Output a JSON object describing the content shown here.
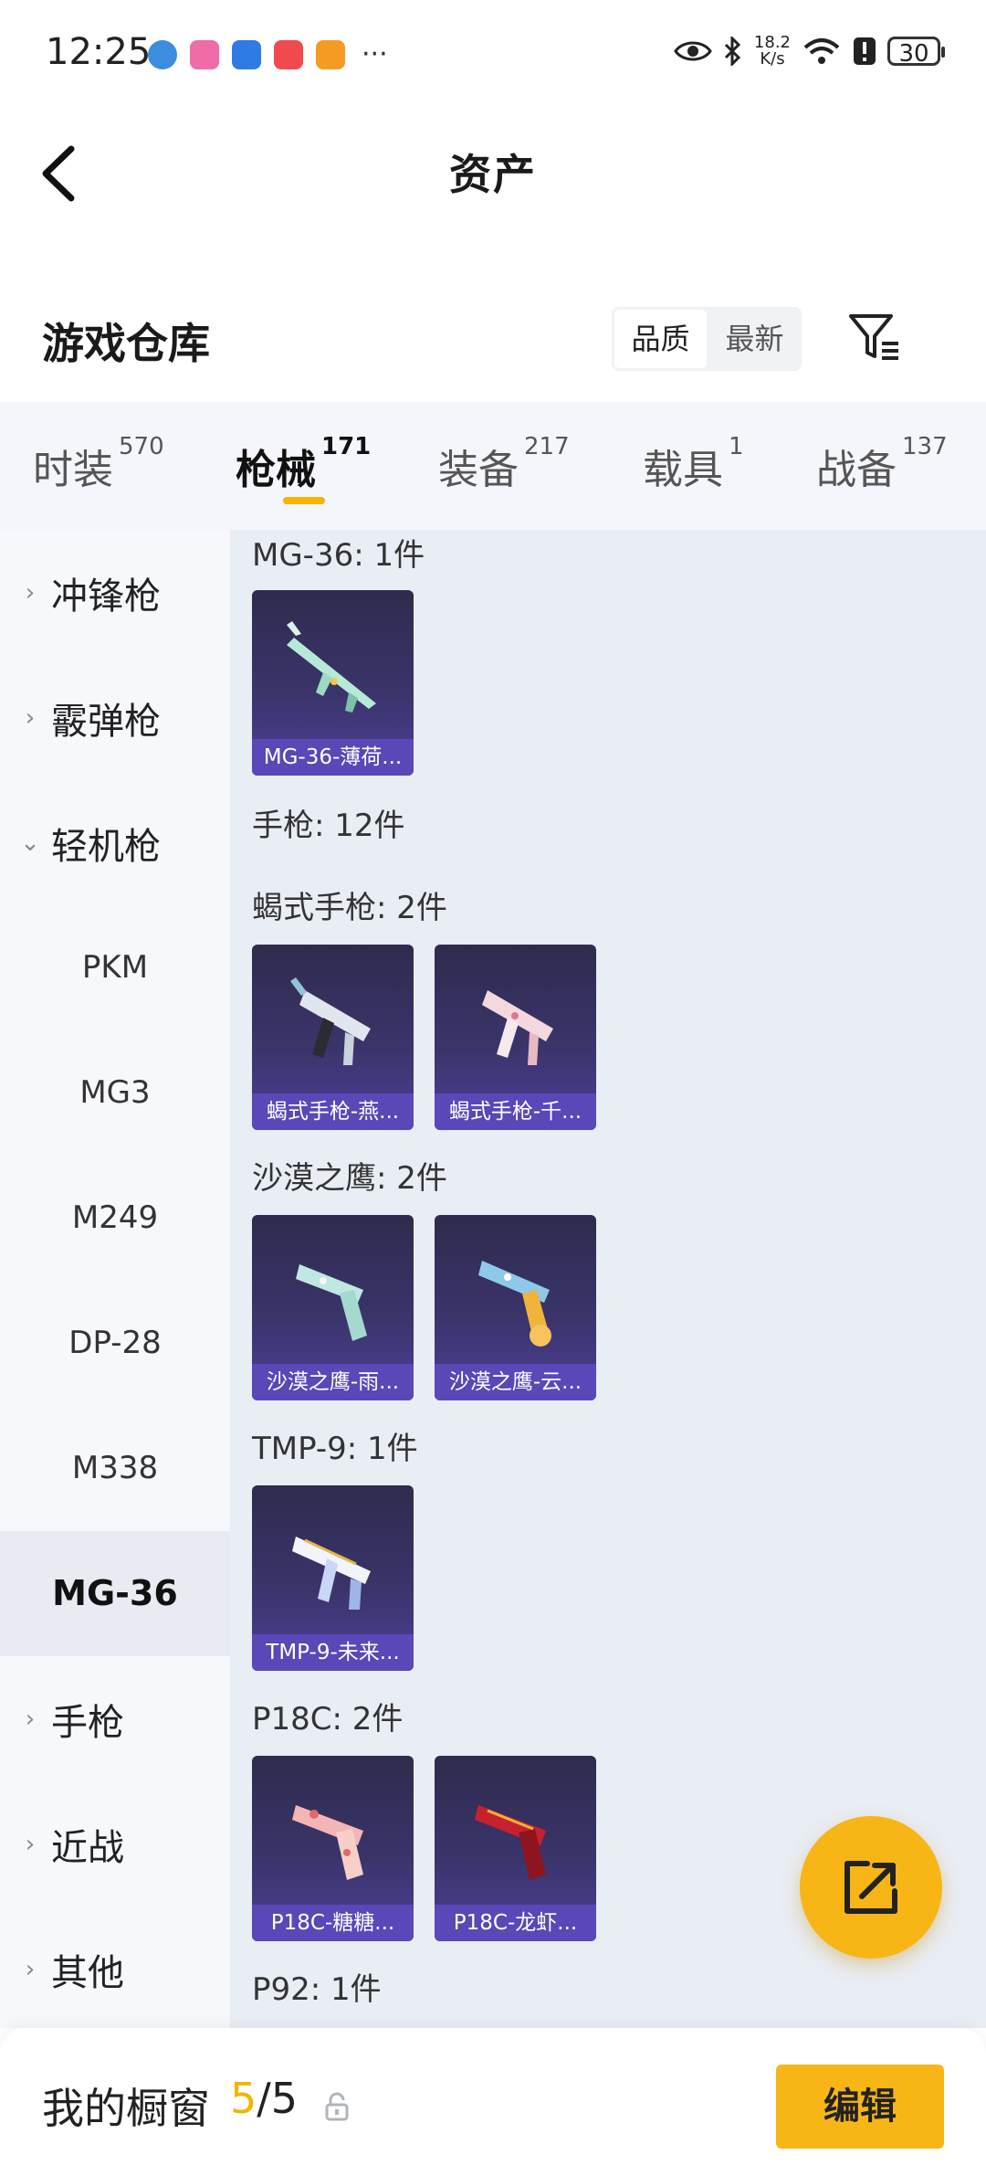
{
  "status_bar": {
    "time": "12:25",
    "more": "···",
    "net_speed_value": "18.2",
    "net_speed_unit": "K/s",
    "battery": "30",
    "notification_icons": [
      {
        "name": "browser-icon",
        "color": "#3c8dde"
      },
      {
        "name": "bilibili-icon",
        "color": "#f06ca7"
      },
      {
        "name": "bluetooth-app-icon",
        "color": "#2f7be5"
      },
      {
        "name": "shopping-icon",
        "color": "#f04a4f"
      },
      {
        "name": "game-center-icon",
        "color": "#f59a23"
      }
    ]
  },
  "header": {
    "title": "资产"
  },
  "warehouse": {
    "title": "游戏仓库",
    "sort_options": [
      "品质",
      "最新"
    ],
    "active_sort": "品质"
  },
  "tabs": [
    {
      "label": "时装",
      "count": "570"
    },
    {
      "label": "枪械",
      "count": "171",
      "active": true
    },
    {
      "label": "装备",
      "count": "217"
    },
    {
      "label": "载具",
      "count": "1"
    },
    {
      "label": "战备",
      "count": "137"
    }
  ],
  "sidebar": {
    "categories": [
      {
        "label": "冲锋枪",
        "expanded": false
      },
      {
        "label": "霰弹枪",
        "expanded": false
      },
      {
        "label": "轻机枪",
        "expanded": true
      },
      {
        "label": "手枪",
        "expanded": false
      },
      {
        "label": "近战",
        "expanded": false
      },
      {
        "label": "其他",
        "expanded": false
      }
    ],
    "subitems": [
      "PKM",
      "MG3",
      "M249",
      "DP-28",
      "M338",
      "MG-36"
    ],
    "selected": "MG-36"
  },
  "content": {
    "groups": [
      {
        "label": "MG-36: 1件",
        "items": [
          "MG-36-薄荷..."
        ]
      },
      {
        "label": "手枪: 12件",
        "items": []
      },
      {
        "label": "蝎式手枪: 2件",
        "items": [
          "蝎式手枪-燕...",
          "蝎式手枪-千..."
        ]
      },
      {
        "label": "沙漠之鹰: 2件",
        "items": [
          "沙漠之鹰-雨...",
          "沙漠之鹰-云..."
        ]
      },
      {
        "label": "TMP-9: 1件",
        "items": [
          "TMP-9-未来..."
        ]
      },
      {
        "label": "P18C: 2件",
        "items": [
          "P18C-糖糖...",
          "P18C-龙虾..."
        ]
      },
      {
        "label": "P92: 1件",
        "items": []
      }
    ]
  },
  "bottom_bar": {
    "label": "我的橱窗",
    "current": "5",
    "separator": "/",
    "max": "5",
    "edit_label": "编辑"
  },
  "colors": {
    "accent": "#f8b516",
    "card_bg": "#3a346a",
    "card_label_bg": "#5a47b8",
    "content_bg": "#e9edf4",
    "sidebar_bg": "#f6f8fc"
  }
}
